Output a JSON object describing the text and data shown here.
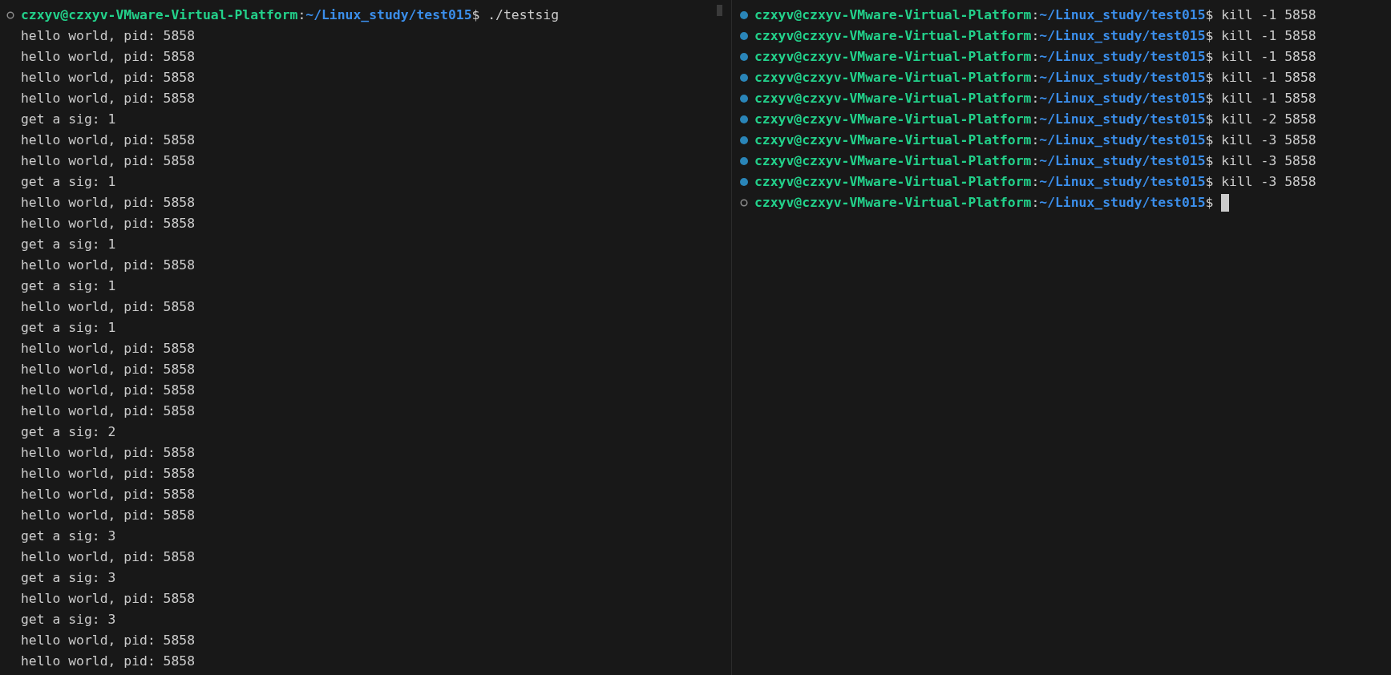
{
  "left_pane": {
    "prompt": {
      "done": false,
      "user_host": "czxyv@czxyv-VMware-Virtual-Platform",
      "sep": ":",
      "path": "~/Linux_study/test015",
      "symbol": "$",
      "command": "./testsig"
    },
    "output": [
      "hello world, pid: 5858",
      "hello world, pid: 5858",
      "hello world, pid: 5858",
      "hello world, pid: 5858",
      "get a sig: 1",
      "hello world, pid: 5858",
      "hello world, pid: 5858",
      "get a sig: 1",
      "hello world, pid: 5858",
      "hello world, pid: 5858",
      "get a sig: 1",
      "hello world, pid: 5858",
      "get a sig: 1",
      "hello world, pid: 5858",
      "get a sig: 1",
      "hello world, pid: 5858",
      "hello world, pid: 5858",
      "hello world, pid: 5858",
      "hello world, pid: 5858",
      "get a sig: 2",
      "hello world, pid: 5858",
      "hello world, pid: 5858",
      "hello world, pid: 5858",
      "hello world, pid: 5858",
      "get a sig: 3",
      "hello world, pid: 5858",
      "get a sig: 3",
      "hello world, pid: 5858",
      "get a sig: 3",
      "hello world, pid: 5858",
      "hello world, pid: 5858"
    ]
  },
  "right_pane": {
    "commands": [
      {
        "done": true,
        "user_host": "czxyv@czxyv-VMware-Virtual-Platform",
        "sep": ":",
        "path": "~/Linux_study/test015",
        "symbol": "$",
        "command": "kill -1 5858"
      },
      {
        "done": true,
        "user_host": "czxyv@czxyv-VMware-Virtual-Platform",
        "sep": ":",
        "path": "~/Linux_study/test015",
        "symbol": "$",
        "command": "kill -1 5858"
      },
      {
        "done": true,
        "user_host": "czxyv@czxyv-VMware-Virtual-Platform",
        "sep": ":",
        "path": "~/Linux_study/test015",
        "symbol": "$",
        "command": "kill -1 5858"
      },
      {
        "done": true,
        "user_host": "czxyv@czxyv-VMware-Virtual-Platform",
        "sep": ":",
        "path": "~/Linux_study/test015",
        "symbol": "$",
        "command": "kill -1 5858"
      },
      {
        "done": true,
        "user_host": "czxyv@czxyv-VMware-Virtual-Platform",
        "sep": ":",
        "path": "~/Linux_study/test015",
        "symbol": "$",
        "command": "kill -1 5858"
      },
      {
        "done": true,
        "user_host": "czxyv@czxyv-VMware-Virtual-Platform",
        "sep": ":",
        "path": "~/Linux_study/test015",
        "symbol": "$",
        "command": "kill -2 5858"
      },
      {
        "done": true,
        "user_host": "czxyv@czxyv-VMware-Virtual-Platform",
        "sep": ":",
        "path": "~/Linux_study/test015",
        "symbol": "$",
        "command": "kill -3 5858"
      },
      {
        "done": true,
        "user_host": "czxyv@czxyv-VMware-Virtual-Platform",
        "sep": ":",
        "path": "~/Linux_study/test015",
        "symbol": "$",
        "command": "kill -3 5858"
      },
      {
        "done": true,
        "user_host": "czxyv@czxyv-VMware-Virtual-Platform",
        "sep": ":",
        "path": "~/Linux_study/test015",
        "symbol": "$",
        "command": "kill -3 5858"
      },
      {
        "done": false,
        "user_host": "czxyv@czxyv-VMware-Virtual-Platform",
        "sep": ":",
        "path": "~/Linux_study/test015",
        "symbol": "$"
      }
    ],
    "cursor": true
  }
}
